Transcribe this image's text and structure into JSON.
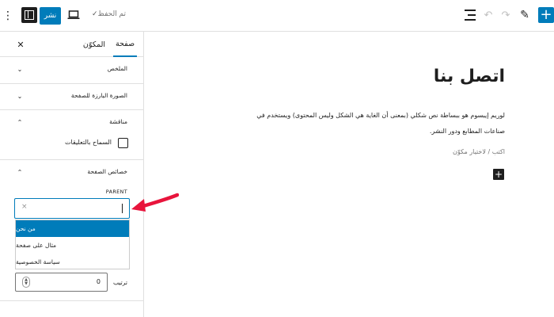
{
  "toolbar": {
    "publish_label": "نشر",
    "saved_label": "تم الحفظ",
    "saved_check": "✓",
    "kebab_glyph": "⋮",
    "undo_glyph": "↶",
    "redo_glyph": "↷",
    "pen_glyph": "✎",
    "inserter_glyph": "+"
  },
  "sidebar": {
    "tabs": [
      {
        "label": "صفحة",
        "active": true
      },
      {
        "label": "المكوّن",
        "active": false
      }
    ],
    "close_glyph": "✕",
    "panels": [
      {
        "title": "الملخص",
        "state": "collapsed"
      },
      {
        "title": "الصورة البارزة للصفحة",
        "state": "collapsed"
      },
      {
        "title": "مناقشة",
        "state": "expanded",
        "checkbox_label": "السماح بالتعليقات",
        "checked": false
      },
      {
        "title": "خصائص الصفحة",
        "state": "expanded"
      }
    ],
    "chevron_down": "⌄",
    "chevron_up": "⌃",
    "parent": {
      "label": "PARENT",
      "value": "",
      "clear_glyph": "×",
      "options": [
        {
          "label": "من نحن",
          "highlighted": true
        },
        {
          "label": "مثال على صفحة",
          "highlighted": false
        },
        {
          "label": "سياسة الخصوصية",
          "highlighted": false
        }
      ]
    },
    "order": {
      "label": "ترتيب",
      "value": "0"
    }
  },
  "canvas": {
    "title": "اتصل بنا",
    "paragraph": "لوريم إيبسوم هو ببساطة نص شكلي (بمعنى أن الغاية هي الشكل وليس المحتوى) ويستخدم في صناعات المطابع ودور النشر.",
    "placeholder": "اكتب / لاختيار مكوّن",
    "inserter_glyph": "+"
  },
  "colors": {
    "accent": "#007cba",
    "annotation_arrow": "#e8143c"
  }
}
